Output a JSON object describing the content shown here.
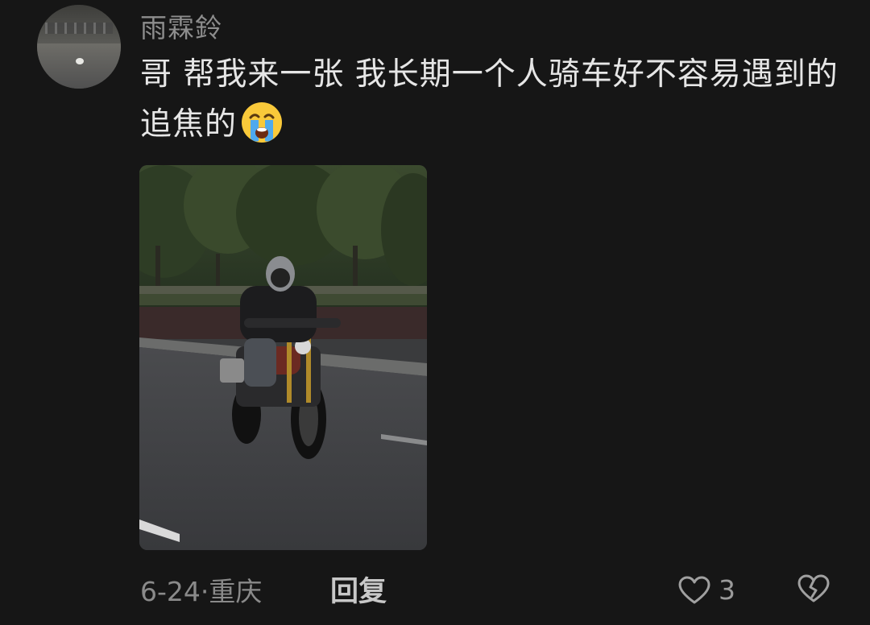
{
  "comment": {
    "username": "雨霖鈴",
    "text": "哥 帮我来一张 我长期一个人骑车好不容易遇到的追焦的",
    "emoji": "loudly-crying-face-emoji",
    "date_location": "6-24·重庆",
    "reply_label": "回复",
    "like_count": "3"
  },
  "icons": {
    "like": "heart-outline-icon",
    "dislike": "broken-heart-outline-icon"
  },
  "colors": {
    "background": "#161616",
    "text_primary": "#e6e6e6",
    "text_secondary": "#8d8d8d"
  }
}
